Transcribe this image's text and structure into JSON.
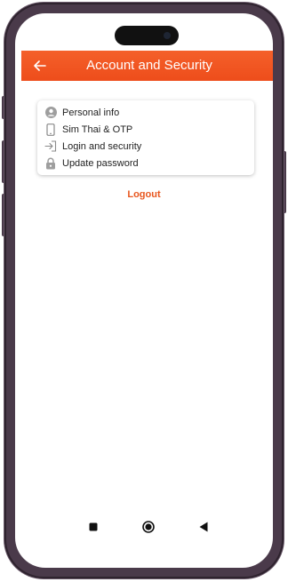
{
  "header": {
    "title": "Account and Security",
    "back_icon": "arrow-left-icon"
  },
  "menu": {
    "items": [
      {
        "label": "Personal info",
        "icon": "person-circle-icon"
      },
      {
        "label": "Sim Thai & OTP",
        "icon": "smartphone-icon"
      },
      {
        "label": "Login and security",
        "icon": "login-icon"
      },
      {
        "label": "Update password",
        "icon": "lock-icon"
      }
    ]
  },
  "logout_label": "Logout",
  "navbar": {
    "icons": [
      "square-recents-icon",
      "circle-home-icon",
      "triangle-back-icon"
    ]
  },
  "colors": {
    "accent": "#ee4d1b",
    "logout": "#e8561e",
    "frame": "#4a3a4a"
  }
}
